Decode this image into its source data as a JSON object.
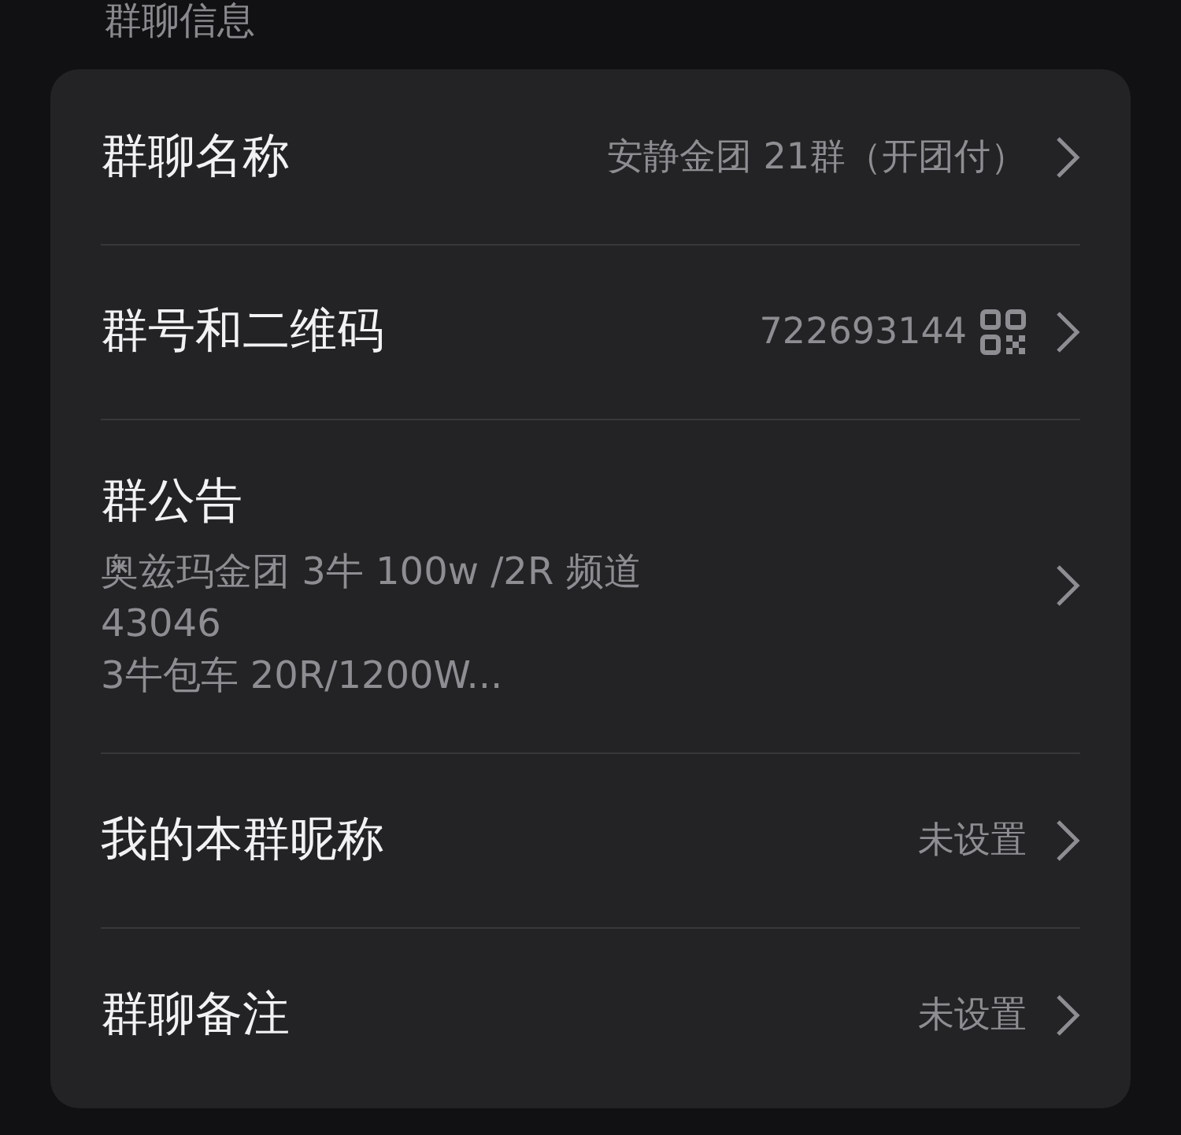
{
  "section_title": "群聊信息",
  "rows": [
    {
      "kind": "value",
      "label": "群聊名称",
      "value": "安静金团 21群（开团付）"
    },
    {
      "kind": "qr",
      "label": "群号和二维码",
      "value": "722693144"
    },
    {
      "kind": "notice",
      "label": "群公告",
      "lines": [
        "奥兹玛金团 3牛 100w /2R 频道",
        "43046",
        "3牛包车 20R/1200W..."
      ]
    },
    {
      "kind": "value",
      "label": "我的本群昵称",
      "value": "未设置"
    },
    {
      "kind": "value",
      "label": "群聊备注",
      "value": "未设置"
    }
  ]
}
